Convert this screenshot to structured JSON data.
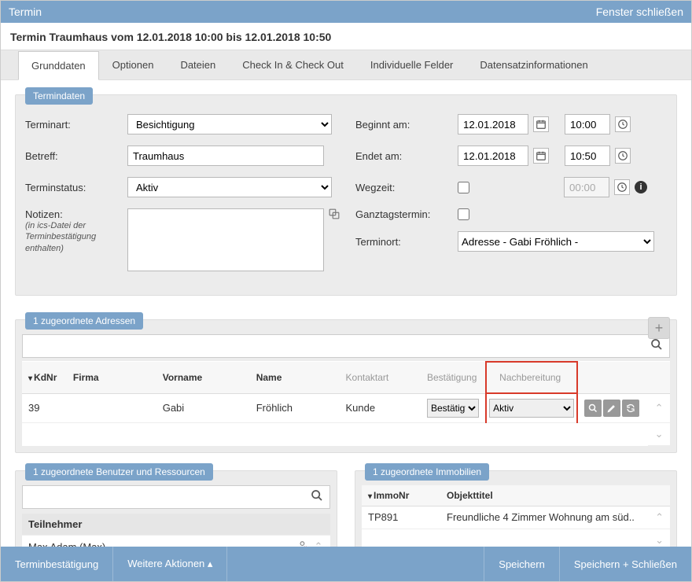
{
  "titlebar": {
    "title": "Termin",
    "close": "Fenster schließen"
  },
  "subtitle": "Termin Traumhaus vom 12.01.2018 10:00 bis 12.01.2018 10:50",
  "tabs": {
    "grunddaten": "Grunddaten",
    "optionen": "Optionen",
    "dateien": "Dateien",
    "checkin": "Check In & Check Out",
    "individuelle": "Individuelle Felder",
    "datensatz": "Datensatzinformationen"
  },
  "termindaten": {
    "section_label": "Termindaten",
    "labels": {
      "terminart": "Terminart:",
      "betreff": "Betreff:",
      "terminstatus": "Terminstatus:",
      "notizen": "Notizen:",
      "notizen_hint": "(in ics-Datei der Terminbestätigung enthalten)",
      "beginnt": "Beginnt am:",
      "endet": "Endet am:",
      "wegzeit": "Wegzeit:",
      "ganztag": "Ganztagstermin:",
      "terminort": "Terminort:"
    },
    "values": {
      "terminart": "Besichtigung",
      "betreff": "Traumhaus",
      "terminstatus": "Aktiv",
      "notizen": "",
      "begin_date": "12.01.2018",
      "begin_time": "10:00",
      "end_date": "12.01.2018",
      "end_time": "10:50",
      "wegzeit_time": "00:00",
      "terminort": "Adresse - Gabi Fröhlich -"
    }
  },
  "adressen": {
    "section_label": "1 zugeordnete Adressen",
    "headers": {
      "kdnr": "KdNr",
      "firma": "Firma",
      "vorname": "Vorname",
      "name": "Name",
      "kontaktart": "Kontaktart",
      "bestaetigung": "Bestätigung",
      "nachbereitung": "Nachbereitung"
    },
    "row": {
      "kdnr": "39",
      "firma": "",
      "vorname": "Gabi",
      "name": "Fröhlich",
      "kontaktart": "Kunde",
      "bestaetigung": "Bestätigt",
      "nachbereitung": "Aktiv"
    }
  },
  "benutzer": {
    "section_label": "1 zugeordnete Benutzer und Ressourcen",
    "teilnehmer_header": "Teilnehmer",
    "teilnehmer": "Max Adam (Max)"
  },
  "immobilien": {
    "section_label": "1 zugeordnete Immobilien",
    "headers": {
      "immonr": "ImmoNr",
      "objekttitel": "Objekttitel"
    },
    "row": {
      "immonr": "TP891",
      "objekttitel": "Freundliche 4 Zimmer Wohnung am süd.."
    }
  },
  "footer": {
    "terminbestaetigung": "Terminbestätigung",
    "weitere": "Weitere Aktionen  ▴",
    "speichern": "Speichern",
    "speichern_schliessen": "Speichern + Schließen"
  }
}
